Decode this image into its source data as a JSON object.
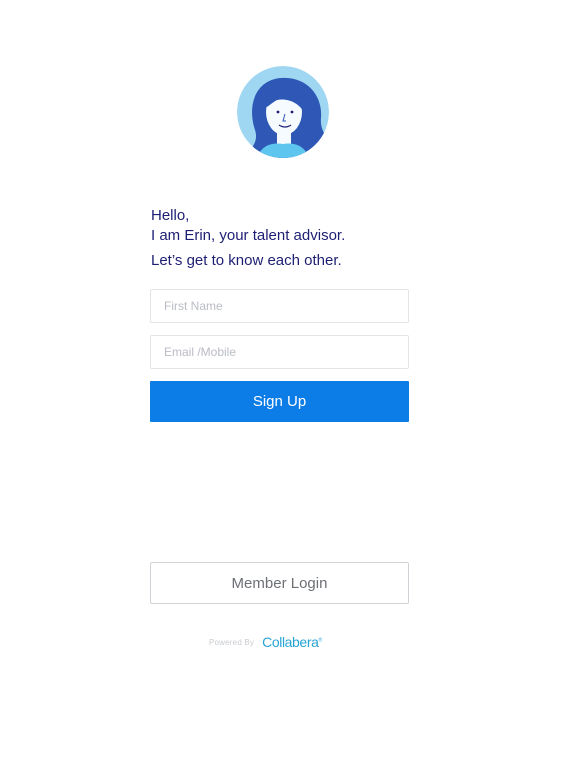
{
  "advisor": {
    "avatar_icon": "woman-avatar-icon"
  },
  "greeting": {
    "line1": "Hello,",
    "line2": "I am Erin, your talent advisor.",
    "line3": "Let’s get to know each other."
  },
  "form": {
    "first_name_placeholder": "First Name",
    "first_name_value": "",
    "contact_placeholder": "Email /Mobile",
    "contact_value": "",
    "signup_label": "Sign Up"
  },
  "member_login_label": "Member Login",
  "footer": {
    "powered_by": "Powered By",
    "brand": "Collabera"
  },
  "colors": {
    "primary": "#0c7ce6",
    "heading": "#1d1f73",
    "brand": "#27a4d6",
    "avatar_bg": "#9fd7f3",
    "hair": "#2e57b6"
  }
}
